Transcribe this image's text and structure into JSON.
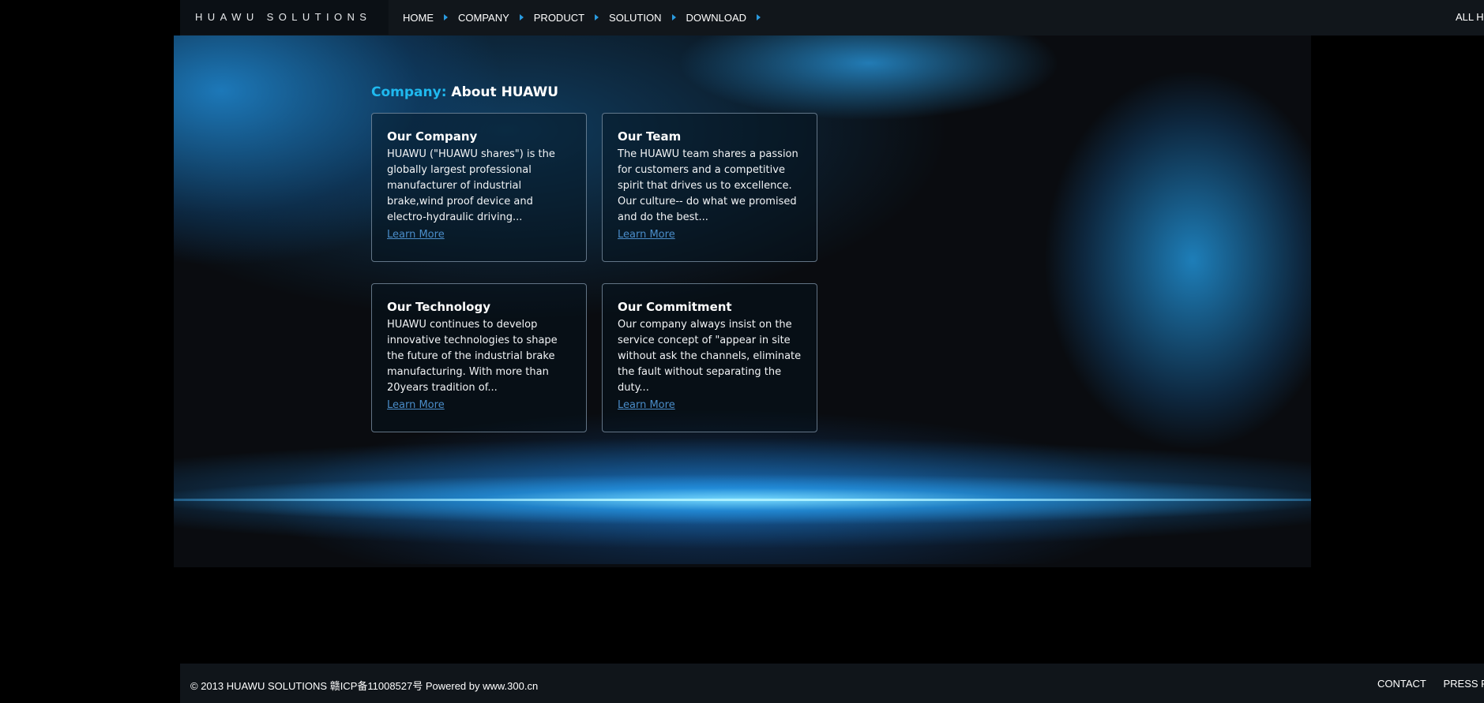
{
  "header": {
    "brand": "HUAWU SOLUTIONS",
    "nav": [
      {
        "label": "HOME"
      },
      {
        "label": "COMPANY"
      },
      {
        "label": "PRODUCT"
      },
      {
        "label": "SOLUTION"
      },
      {
        "label": "DOWNLOAD"
      }
    ],
    "right_link": "ALL H"
  },
  "main": {
    "title_accent": "Company:",
    "title_main": "About HUAWU",
    "cards": [
      {
        "title": "Our Company",
        "text": "HUAWU (\"HUAWU shares\") is the globally largest professional manufacturer of industrial brake,wind proof device and electro-hydraulic driving...",
        "link": "Learn More"
      },
      {
        "title": "Our Team",
        "text": "The HUAWU team shares a passion for customers and a competitive spirit that drives us to excellence. Our culture-- do what we promised and do the best...",
        "link": "Learn More"
      },
      {
        "title": "Our Technology",
        "text": "HUAWU continues to develop innovative technologies to shape the future of the industrial brake manufacturing. With more than 20years tradition of...",
        "link": "Learn More"
      },
      {
        "title": "Our Commitment",
        "text": "Our company always insist on the service concept of \"appear in site without ask the channels, eliminate the fault without separating the duty...",
        "link": "Learn More"
      }
    ]
  },
  "footer": {
    "copyright": "© 2013  HUAWU  SOLUTIONS  赣ICP备11008527号  Powered by www.300.cn",
    "links": [
      "CONTACT",
      "PRESS R"
    ]
  },
  "colors": {
    "accent": "#1fb9ef",
    "nav_arrow": "#2a9be0",
    "link": "#4a8cc8"
  }
}
